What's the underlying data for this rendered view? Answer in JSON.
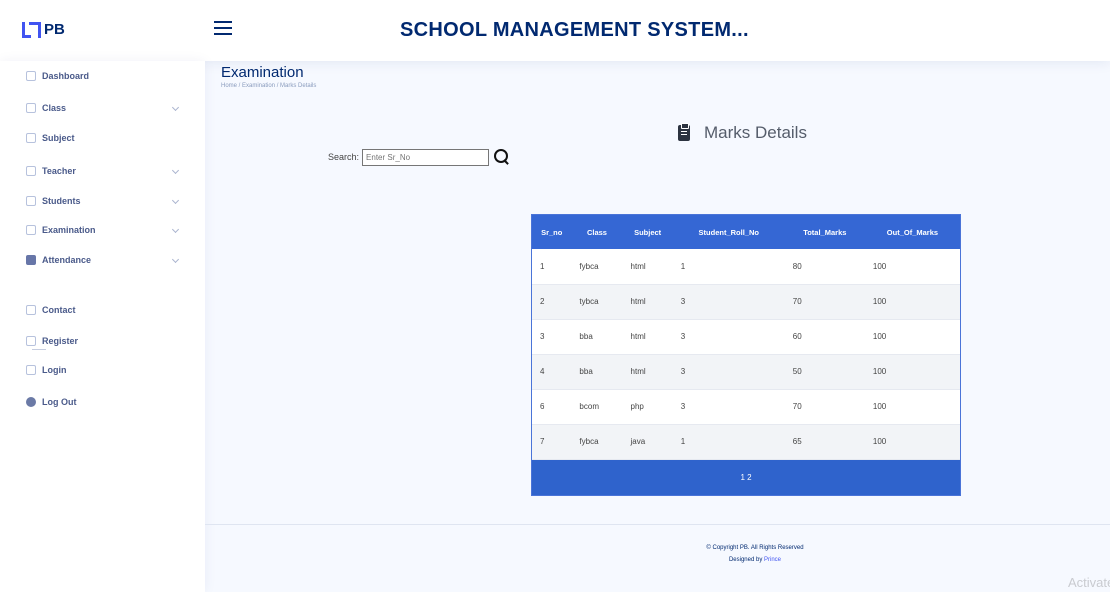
{
  "brand": {
    "logo_text": "PB"
  },
  "header": {
    "title": "SCHOOL MANAGEMENT SYSTEM..."
  },
  "sidebar": {
    "items": [
      {
        "label": "Dashboard",
        "icon": "grid-icon",
        "has_submenu": false
      },
      {
        "label": "Class",
        "icon": "building-icon",
        "has_submenu": true
      },
      {
        "label": "Subject",
        "icon": "grid-icon",
        "has_submenu": false
      },
      {
        "label": "Teacher",
        "icon": "person-icon",
        "has_submenu": true
      },
      {
        "label": "Students",
        "icon": "people-icon",
        "has_submenu": true
      },
      {
        "label": "Examination",
        "icon": "document-icon",
        "has_submenu": true
      },
      {
        "label": "Attendance",
        "icon": "table-icon",
        "has_submenu": true
      },
      {
        "label": "Contact",
        "icon": "envelope-icon",
        "has_submenu": false
      },
      {
        "label": "Register",
        "icon": "card-icon",
        "has_submenu": false
      },
      {
        "label": "Login",
        "icon": "login-icon",
        "has_submenu": false
      },
      {
        "label": "Log Out",
        "icon": "power-icon",
        "has_submenu": false
      }
    ]
  },
  "page": {
    "title": "Examination",
    "breadcrumb": "Home / Examination / Marks Details"
  },
  "section": {
    "title": "Marks Details",
    "icon": "clipboard-icon"
  },
  "search": {
    "label": "Search:",
    "placeholder": "Enter Sr_No"
  },
  "table": {
    "headers": [
      "Sr_no",
      "Class",
      "Subject",
      "Student_Roll_No",
      "Total_Marks",
      "Out_Of_Marks"
    ],
    "rows": [
      [
        "1",
        "fybca",
        "html",
        "1",
        "80",
        "100"
      ],
      [
        "2",
        "tybca",
        "html",
        "3",
        "70",
        "100"
      ],
      [
        "3",
        "bba",
        "html",
        "3",
        "60",
        "100"
      ],
      [
        "4",
        "bba",
        "html",
        "3",
        "50",
        "100"
      ],
      [
        "6",
        "bcom",
        "php",
        "3",
        "70",
        "100"
      ],
      [
        "7",
        "fybca",
        "java",
        "1",
        "65",
        "100"
      ]
    ],
    "pagination": "1 2"
  },
  "footer": {
    "copyright": "© Copyright PB. All Rights Reserved",
    "designed_prefix": "Designed by ",
    "designed_name": "Prince"
  },
  "watermark": "Activate",
  "colors": {
    "primary": "#4154f1",
    "header_blue": "#3567d4",
    "text_dark": "#012970"
  }
}
